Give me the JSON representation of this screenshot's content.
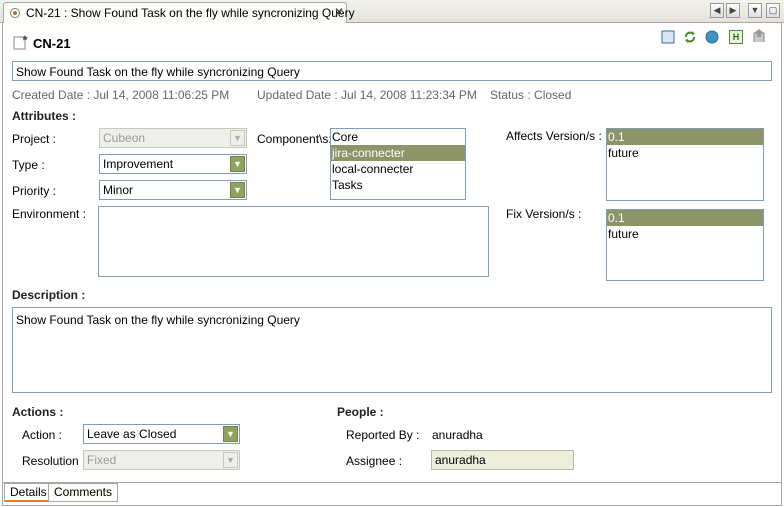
{
  "tab": {
    "title": "CN-21 : Show Found Task on the fly while syncronizing Query",
    "close": "✕",
    "nav_left": "◀",
    "nav_right": "▶",
    "nav_down": "▼",
    "restore": "▢"
  },
  "header": {
    "issue_key": "CN-21",
    "toolbar_h_label": "H"
  },
  "summary": "Show Found Task on the fly while syncronizing Query",
  "meta": {
    "created": "Created Date : Jul 14, 2008 11:06:25 PM",
    "updated": "Updated Date : Jul 14, 2008 11:23:34 PM",
    "status": "Status : Closed"
  },
  "attributes": {
    "heading": "Attributes :",
    "project_label": "Project :",
    "project_value": "Cubeon",
    "type_label": "Type :",
    "type_value": "Improvement",
    "priority_label": "Priority :",
    "priority_value": "Minor",
    "environment_label": "Environment :",
    "components_label": "Component\\s:",
    "components": [
      "Core",
      "jira-connecter",
      "local-connecter",
      "Tasks"
    ],
    "components_selected_index": 1,
    "affects_label": "Affects Version/s :",
    "affects_versions": [
      "0.1",
      "future"
    ],
    "affects_selected_index": 0,
    "fix_label": "Fix Version/s :",
    "fix_versions": [
      "0.1",
      "future"
    ],
    "fix_selected_index": 0
  },
  "description": {
    "heading": "Description :",
    "text": "Show Found Task on the fly while syncronizing Query"
  },
  "actions": {
    "heading": "Actions :",
    "action_label": "Action :",
    "action_value": "Leave as Closed",
    "resolution_label": "Resolution :",
    "resolution_value": "Fixed"
  },
  "people": {
    "heading": "People :",
    "reported_label": "Reported By :",
    "reported_value": "anuradha",
    "assignee_label": "Assignee :",
    "assignee_value": "anuradha"
  },
  "bottom_tabs": [
    "Details",
    "Comments"
  ],
  "colors": {
    "selection": "#8d9467",
    "combo_arrow": "#8ea35f",
    "field_border": "#7f9db9",
    "heading_text": "#222222",
    "meta_text": "#666666"
  },
  "icons": [
    "document-icon",
    "close-icon",
    "scroll-left-icon",
    "scroll-right-icon",
    "dropdown-icon",
    "restore-icon",
    "issue-icon",
    "stop-icon",
    "sync-icon",
    "globe-icon",
    "html-icon",
    "export-icon",
    "chevron-down-icon"
  ]
}
